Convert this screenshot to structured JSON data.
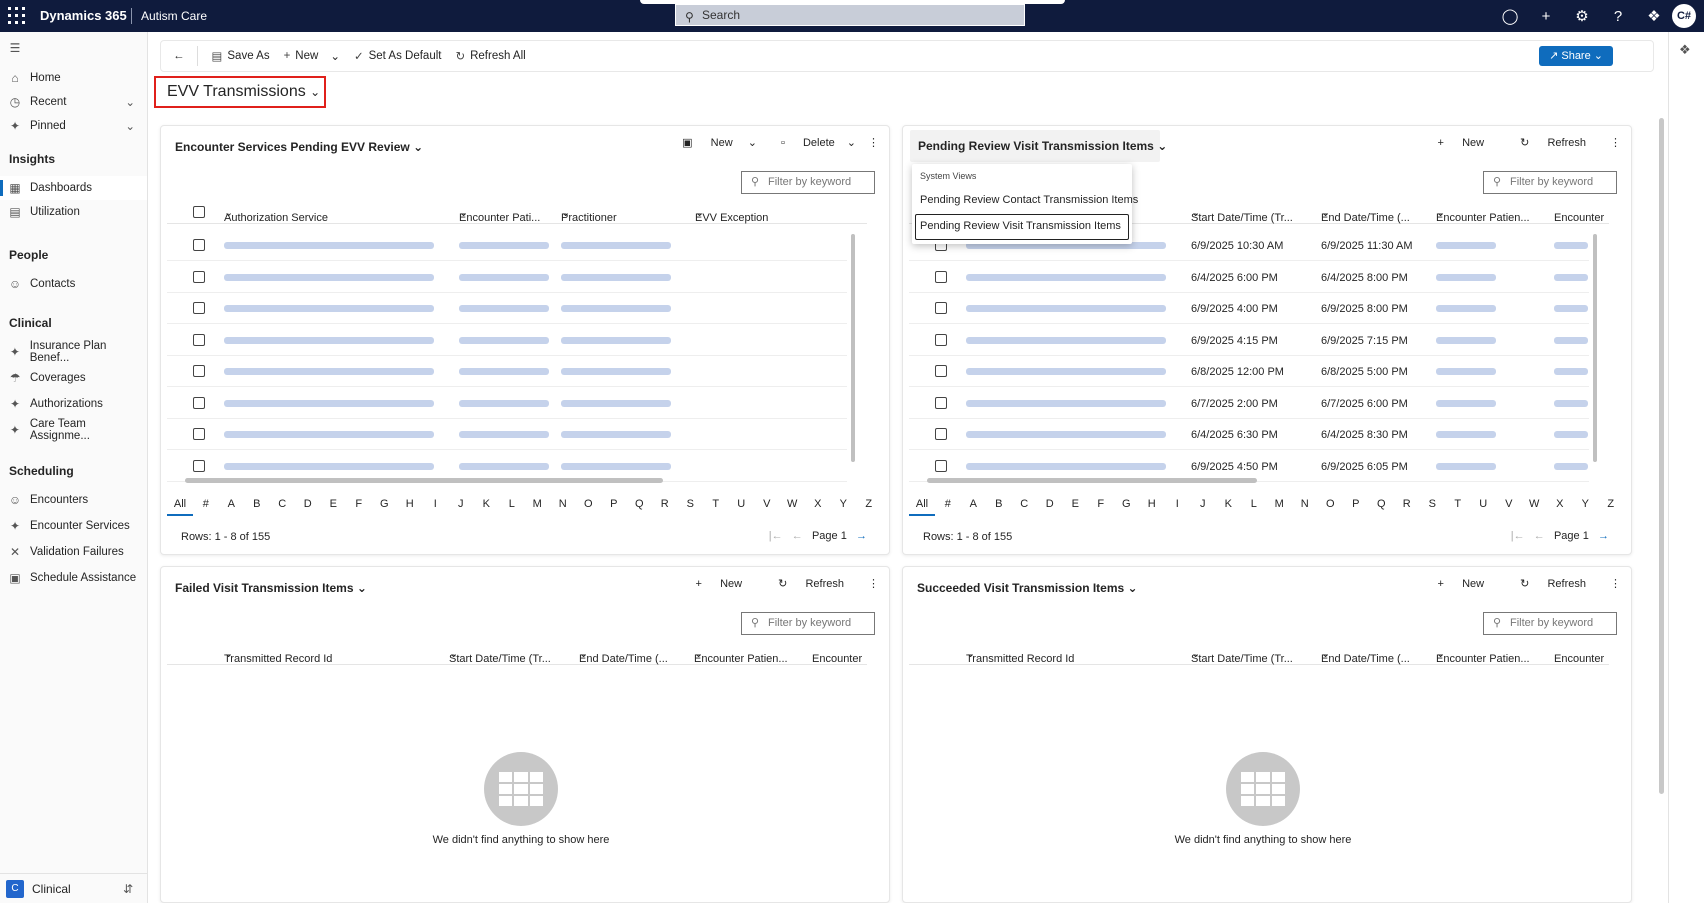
{
  "topbar": {
    "brand": "Dynamics 365",
    "app": "Autism Care",
    "search_placeholder": "Search",
    "avatar": "C#"
  },
  "sidebar": {
    "items": [
      {
        "label": "Home",
        "icon": "home-icon"
      },
      {
        "label": "Recent",
        "icon": "clock-icon"
      },
      {
        "label": "Pinned",
        "icon": "pin-icon"
      }
    ],
    "groups": [
      {
        "title": "Insights",
        "items": [
          "Dashboards",
          "Utilization"
        ]
      },
      {
        "title": "People",
        "items": [
          "Contacts"
        ]
      },
      {
        "title": "Clinical",
        "items": [
          "Insurance Plan Benef...",
          "Coverages",
          "Authorizations",
          "Care Team Assignme..."
        ]
      },
      {
        "title": "Scheduling",
        "items": [
          "Encounters",
          "Encounter Services",
          "Validation Failures",
          "Schedule Assistance"
        ]
      }
    ],
    "area": {
      "badge": "C",
      "label": "Clinical"
    }
  },
  "cmdbar": {
    "save_as": "Save As",
    "new": "New",
    "set_default": "Set As Default",
    "refresh_all": "Refresh All",
    "share": "Share"
  },
  "dashboard_title": "EVV Transmissions",
  "alphabet": [
    "All",
    "#",
    "A",
    "B",
    "C",
    "D",
    "E",
    "F",
    "G",
    "H",
    "I",
    "J",
    "K",
    "L",
    "M",
    "N",
    "O",
    "P",
    "Q",
    "R",
    "S",
    "T",
    "U",
    "V",
    "W",
    "X",
    "Y",
    "Z"
  ],
  "panels": {
    "p1": {
      "title": "Encounter Services Pending EVV Review",
      "new": "New",
      "delete": "Delete",
      "filter": "Filter by keyword",
      "columns": [
        "Authorization Service",
        "Encounter Pati...",
        "Practitioner",
        "EVV Exception"
      ],
      "rows_text": "Rows: 1 - 8 of 155",
      "page": "Page 1"
    },
    "p2": {
      "title": "Pending Review Visit Transmission Items",
      "new": "New",
      "refresh": "Refresh",
      "filter": "Filter by keyword",
      "columns": [
        "Start Date/Time (Tr...",
        "End Date/Time (...",
        "Encounter Patien...",
        "Encounter"
      ],
      "rows": [
        {
          "start": "6/9/2025 10:30 AM",
          "end": "6/9/2025 11:30 AM"
        },
        {
          "start": "6/4/2025 6:00 PM",
          "end": "6/4/2025 8:00 PM"
        },
        {
          "start": "6/9/2025 4:00 PM",
          "end": "6/9/2025 8:00 PM"
        },
        {
          "start": "6/9/2025 4:15 PM",
          "end": "6/9/2025 7:15 PM"
        },
        {
          "start": "6/8/2025 12:00 PM",
          "end": "6/8/2025 5:00 PM"
        },
        {
          "start": "6/7/2025 2:00 PM",
          "end": "6/7/2025 6:00 PM"
        },
        {
          "start": "6/4/2025 6:30 PM",
          "end": "6/4/2025 8:30 PM"
        },
        {
          "start": "6/9/2025 4:50 PM",
          "end": "6/9/2025 6:05 PM"
        }
      ],
      "rows_text": "Rows: 1 - 8 of 155",
      "page": "Page 1",
      "dropdown": {
        "header": "System Views",
        "items": [
          "Pending Review Contact Transmission Items",
          "Pending Review Visit Transmission Items"
        ]
      }
    },
    "p3": {
      "title": "Failed Visit Transmission Items",
      "new": "New",
      "refresh": "Refresh",
      "filter": "Filter by keyword",
      "columns": [
        "Transmitted Record Id",
        "Start Date/Time (Tr...",
        "End Date/Time (...",
        "Encounter Patien...",
        "Encounter"
      ],
      "empty": "We didn't find anything to show here"
    },
    "p4": {
      "title": "Succeeded Visit Transmission Items",
      "new": "New",
      "refresh": "Refresh",
      "filter": "Filter by keyword",
      "columns": [
        "Transmitted Record Id",
        "Start Date/Time (Tr...",
        "End Date/Time (...",
        "Encounter Patien...",
        "Encounter"
      ],
      "empty": "We didn't find anything to show here"
    }
  }
}
